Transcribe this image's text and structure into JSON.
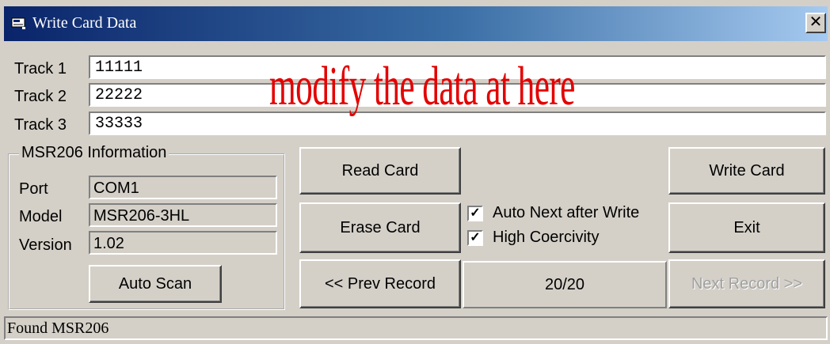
{
  "window": {
    "title": "Write Card Data",
    "close_glyph": "✕",
    "app_icon": "card-reader-icon"
  },
  "tracks": [
    {
      "label": "Track 1",
      "value": "11111"
    },
    {
      "label": "Track 2",
      "value": "22222"
    },
    {
      "label": "Track 3",
      "value": "33333"
    }
  ],
  "annotation": "modify the data at here",
  "info": {
    "group_title": "MSR206 Information",
    "port_label": "Port",
    "port_value": "COM1",
    "model_label": "Model",
    "model_value": "MSR206-3HL",
    "version_label": "Version",
    "version_value": "1.02",
    "auto_scan_label": "Auto Scan"
  },
  "buttons": {
    "read_card": "Read Card",
    "erase_card": "Erase Card",
    "prev_record": "<< Prev Record",
    "write_card": "Write Card",
    "exit": "Exit",
    "next_record": "Next Record >>"
  },
  "options": {
    "auto_next_label": "Auto Next after Write",
    "auto_next_checked": true,
    "high_coercivity_label": "High Coercivity",
    "high_coercivity_checked": true,
    "check_glyph": "✓"
  },
  "record_counter": "20/20",
  "status_text": "Found MSR206",
  "colors": {
    "title_bar_start": "#0a246a",
    "title_bar_end": "#a6caf0",
    "annotation": "#e30000",
    "face": "#d4d0c8"
  }
}
